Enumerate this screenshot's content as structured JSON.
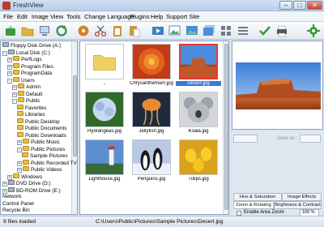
{
  "window": {
    "title": "FreshView",
    "minimize_glyph": "–",
    "maximize_glyph": "□",
    "close_glyph": "✕"
  },
  "menu": {
    "items": [
      "File",
      "Edit",
      "Image",
      "View",
      "Tools",
      "Change Language",
      "Plugins",
      "Help",
      "Support Site"
    ]
  },
  "toolbar": {
    "buttons": [
      {
        "icon": "load-icon",
        "color": "#3a9a3a"
      },
      {
        "icon": "folder-open-icon",
        "color": "#e0b23c"
      },
      {
        "icon": "computer-icon",
        "color": "#6b7d92"
      },
      {
        "icon": "refresh-icon",
        "color": "#2e8b57"
      },
      {
        "icon": "disc-icon",
        "color": "#d9822b"
      },
      {
        "icon": "scissors-icon",
        "color": "#c0392b"
      },
      {
        "icon": "clipboard-icon",
        "color": "#c79a3c"
      },
      {
        "icon": "paste-icon",
        "color": "#c79a3c"
      },
      {
        "icon": "slideshow-icon",
        "color": "#3f7fbf"
      },
      {
        "icon": "edit-picture-icon",
        "color": "#4a8fd8"
      },
      {
        "icon": "image-icon",
        "color": "#4a8fd8"
      },
      {
        "icon": "images-icon",
        "color": "#4a8fd8"
      },
      {
        "icon": "grid-icon",
        "color": "#6b7d92"
      },
      {
        "icon": "list-icon",
        "color": "#6b7d92"
      },
      {
        "icon": "checkmark-icon",
        "color": "#3a9a3a"
      },
      {
        "icon": "printer-icon",
        "color": "#556"
      },
      {
        "icon": "gear-icon",
        "color": "#3a9a3a"
      }
    ]
  },
  "tree": {
    "items": [
      {
        "label": "Floppy Disk Drive (A:)",
        "level": 0,
        "kind": "drive",
        "expander": ""
      },
      {
        "label": "Local Disk (C:)",
        "level": 0,
        "kind": "drive",
        "expander": "-"
      },
      {
        "label": "PerfLogs",
        "level": 1,
        "kind": "folder",
        "expander": "+"
      },
      {
        "label": "Program Files",
        "level": 1,
        "kind": "folder",
        "expander": "+"
      },
      {
        "label": "ProgramData",
        "level": 1,
        "kind": "folder",
        "expander": "+"
      },
      {
        "label": "Users",
        "level": 1,
        "kind": "folder",
        "expander": "-"
      },
      {
        "label": "Admin",
        "level": 2,
        "kind": "folder",
        "expander": "+"
      },
      {
        "label": "Default",
        "level": 2,
        "kind": "folder",
        "expander": "+"
      },
      {
        "label": "Public",
        "level": 2,
        "kind": "folder",
        "expander": "-"
      },
      {
        "label": "Favorites",
        "level": 3,
        "kind": "folder",
        "expander": ""
      },
      {
        "label": "Libraries",
        "level": 3,
        "kind": "folder",
        "expander": ""
      },
      {
        "label": "Public Desktop",
        "level": 3,
        "kind": "folder",
        "expander": ""
      },
      {
        "label": "Public Documents",
        "level": 3,
        "kind": "folder",
        "expander": ""
      },
      {
        "label": "Public Downloads",
        "level": 3,
        "kind": "folder",
        "expander": ""
      },
      {
        "label": "Public Music",
        "level": 3,
        "kind": "folder",
        "expander": "+"
      },
      {
        "label": "Public Pictures",
        "level": 3,
        "kind": "folder",
        "expander": "-"
      },
      {
        "label": "Sample Pictures",
        "level": 4,
        "kind": "folder",
        "expander": ""
      },
      {
        "label": "Public Recorded TV",
        "level": 3,
        "kind": "folder",
        "expander": "+"
      },
      {
        "label": "Public Videos",
        "level": 3,
        "kind": "folder",
        "expander": "+"
      },
      {
        "label": "Windows",
        "level": 1,
        "kind": "folder",
        "expander": "+"
      },
      {
        "label": "DVD Drive (D:)",
        "level": 0,
        "kind": "drive",
        "expander": "+"
      },
      {
        "label": "BD-ROM Drive (E:)",
        "level": 0,
        "kind": "drive",
        "expander": "+"
      },
      {
        "label": "Network",
        "level": 0,
        "kind": "none",
        "expander": ""
      },
      {
        "label": "Control Panel",
        "level": 0,
        "kind": "none",
        "expander": ""
      },
      {
        "label": "Recycle Bin",
        "level": 0,
        "kind": "none",
        "expander": ""
      }
    ]
  },
  "thumbnails": {
    "items": [
      {
        "caption": "..",
        "art": "folder",
        "selected": false
      },
      {
        "caption": "Chrysanthemum.jpg",
        "art": "chrysanthemum",
        "selected": false
      },
      {
        "caption": "Desert.jpg",
        "art": "desert",
        "selected": true
      },
      {
        "caption": "Hydrangeas.jpg",
        "art": "hydrangeas",
        "selected": false
      },
      {
        "caption": "Jellyfish.jpg",
        "art": "jellyfish",
        "selected": false
      },
      {
        "caption": "Koala.jpg",
        "art": "koala",
        "selected": false
      },
      {
        "caption": "Lighthouse.jpg",
        "art": "lighthouse",
        "selected": false
      },
      {
        "caption": "Penguins.jpg",
        "art": "penguins",
        "selected": false
      },
      {
        "caption": "Tulips.jpg",
        "art": "tulips",
        "selected": false
      }
    ]
  },
  "side_panel": {
    "save_as_label": "Save as :",
    "tabs_row1": [
      "Hue & Saturation",
      "Image Effects"
    ],
    "tabs_row2": [
      "Zoom & Rotating",
      "Brightness & Contrast"
    ],
    "checkbox_label": "Enable Area Zoom",
    "zoom_value": "100 %"
  },
  "status": {
    "count": "9 files loaded",
    "path": "C:\\Users\\Public\\Pictures\\Sample Pictures\\Desert.jpg"
  }
}
